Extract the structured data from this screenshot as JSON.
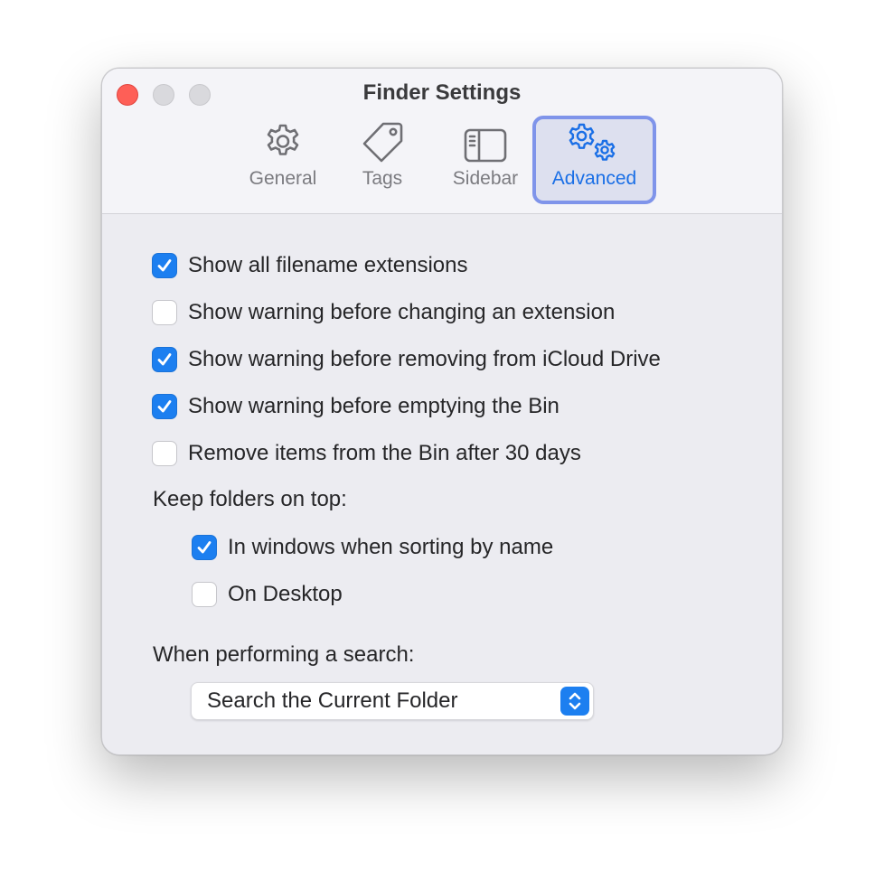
{
  "window": {
    "title": "Finder Settings"
  },
  "tabs": [
    {
      "label": "General",
      "icon": "gear-icon",
      "selected": false
    },
    {
      "label": "Tags",
      "icon": "tag-icon",
      "selected": false
    },
    {
      "label": "Sidebar",
      "icon": "sidebar-icon",
      "selected": false
    },
    {
      "label": "Advanced",
      "icon": "gears-icon",
      "selected": true
    }
  ],
  "options": [
    {
      "label": "Show all filename extensions",
      "checked": true
    },
    {
      "label": "Show warning before changing an extension",
      "checked": false
    },
    {
      "label": "Show warning before removing from iCloud Drive",
      "checked": true
    },
    {
      "label": "Show warning before emptying the Bin",
      "checked": true
    },
    {
      "label": "Remove items from the Bin after 30 days",
      "checked": false
    }
  ],
  "folders_section": {
    "label": "Keep folders on top:",
    "options": [
      {
        "label": "In windows when sorting by name",
        "checked": true
      },
      {
        "label": "On Desktop",
        "checked": false
      }
    ]
  },
  "search_section": {
    "label": "When performing a search:",
    "selected_value": "Search the Current Folder"
  },
  "colors": {
    "accent": "#1c7ff0",
    "close_button": "#fe5f57",
    "selected_tab_border": "#7f94ea"
  }
}
